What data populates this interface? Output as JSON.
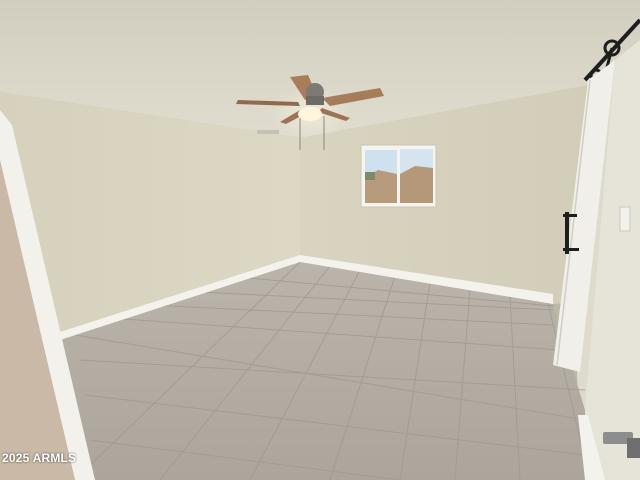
{
  "photo": {
    "watermark": "2025 ARMLS",
    "colors": {
      "ceiling": "#dcd8ca",
      "wall_left": "#d8d4c0",
      "wall_back": "#d4cfbb",
      "wall_right": "#e3e1d4",
      "floor": "#b3ada3",
      "grout": "#9d978d",
      "baseboard": "#f4f3ee",
      "door": "#f0efea",
      "hardware": "#1e1e1e",
      "fan_blade": "#a87d5c",
      "light": "#fff6dc",
      "window_sky": "#cfe0ee",
      "window_hills": "#b99a7d"
    }
  }
}
